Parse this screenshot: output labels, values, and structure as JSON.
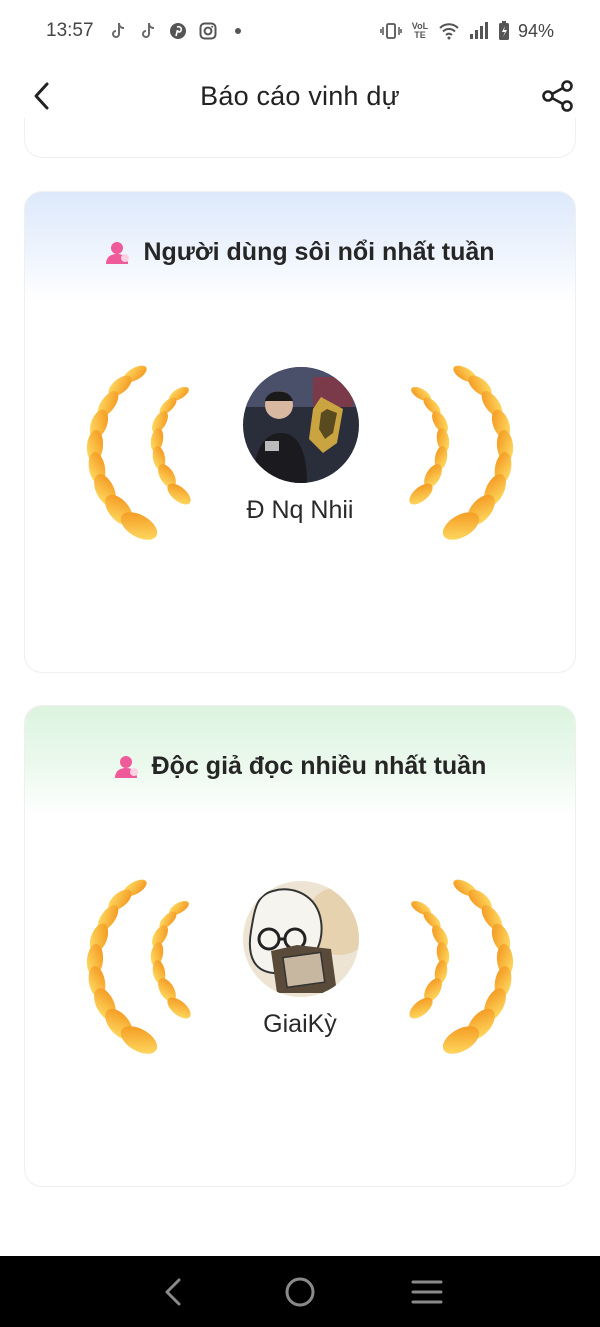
{
  "status_bar": {
    "time": "13:57",
    "notification_icons": [
      "tiktok-icon",
      "tiktok-icon",
      "pinterest-icon",
      "instagram-icon",
      "dot-icon"
    ],
    "system_icons": [
      "vibrate-icon",
      "volte-icon",
      "wifi-icon",
      "signal-icon",
      "battery-icon"
    ],
    "volte_text": "VoLTE",
    "battery": "94%"
  },
  "header": {
    "title": "Báo cáo vinh dự",
    "back_icon": "chevron-left-icon",
    "share_icon": "share-icon"
  },
  "cards": [
    {
      "title": "Người dùng sôi nổi nhất tuần",
      "username": "Đ Nq Nhii",
      "accent": "#dde9fb"
    },
    {
      "title": "Độc giả đọc nhiều nhất tuần",
      "username": "GiaiKỳ",
      "accent": "#dcf4df"
    }
  ],
  "colors": {
    "wreath_light": "#ffd44a",
    "wreath_dark": "#f59a1b",
    "person_icon": "#ee5a9a",
    "nav_bar": "#000000"
  },
  "nav_bar": {
    "buttons": [
      "back-nav-icon",
      "home-nav-icon",
      "recents-nav-icon"
    ]
  }
}
